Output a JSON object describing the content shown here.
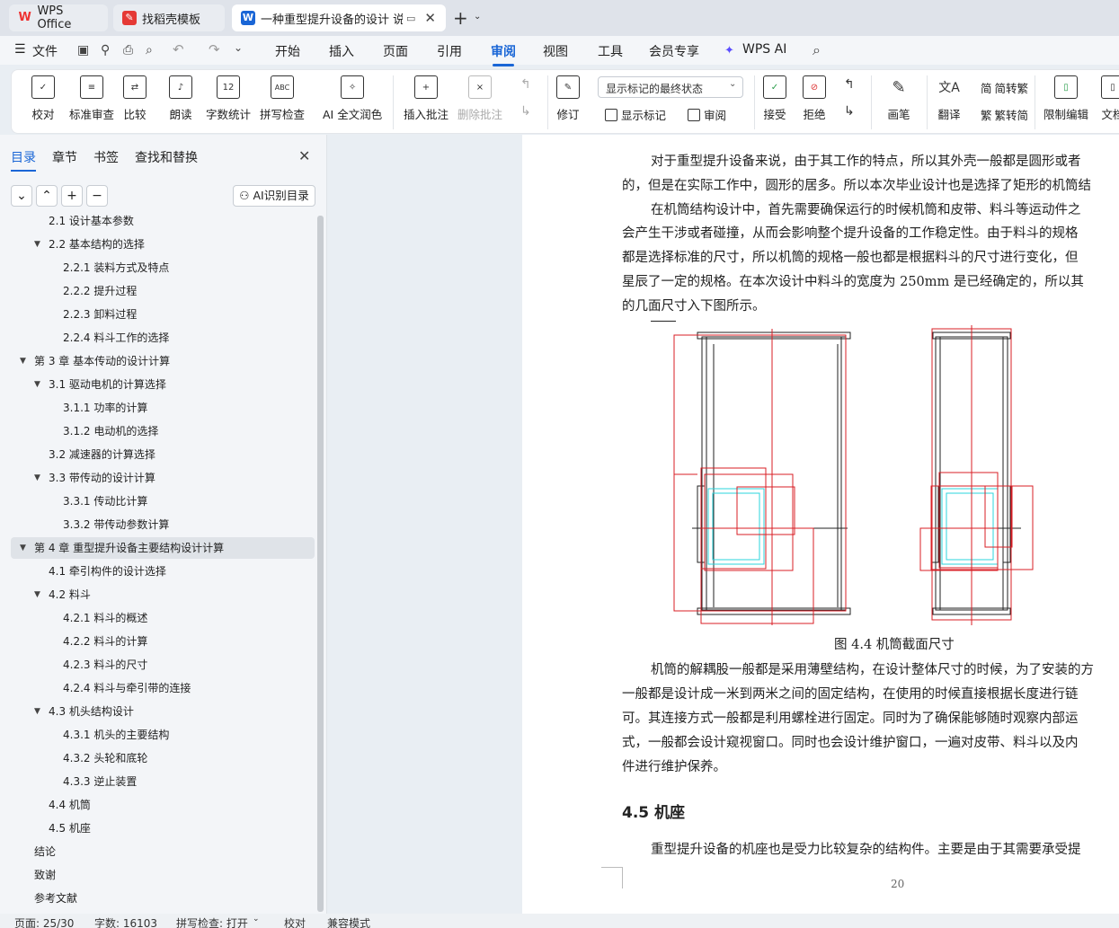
{
  "tabs": [
    {
      "label": "WPS Office"
    },
    {
      "label": "找稻壳模板"
    },
    {
      "label": "一种重型提升设备的设计 说明"
    }
  ],
  "menu": {
    "file": "文件",
    "items": [
      "开始",
      "插入",
      "页面",
      "引用",
      "审阅",
      "视图",
      "工具",
      "会员专享"
    ],
    "wps_ai": "WPS AI"
  },
  "ribbon": {
    "proofread": "校对",
    "std_review": "标准审查",
    "compare": "比较",
    "read_aloud": "朗读",
    "word_count": "字数统计",
    "spell_check": "拼写检查",
    "ai_polish": "AI 全文润色",
    "insert_comment": "插入批注",
    "delete_comment": "删除批注",
    "track": "修订",
    "show_mode": "显示标记的最终状态",
    "show_markup": "显示标记",
    "review": "审阅",
    "accept": "接受",
    "reject": "拒绝",
    "pen": "画笔",
    "translate": "翻译",
    "to_trad": "简转繁",
    "to_simp": "繁转简",
    "restrict": "限制编辑",
    "doc": "文档"
  },
  "nav": {
    "tabs": [
      "目录",
      "章节",
      "书签",
      "查找和替换"
    ],
    "ai_toc": "AI识别目录"
  },
  "toc": [
    {
      "t": "2.1 设计基本参数",
      "l": 2,
      "e": ""
    },
    {
      "t": "2.2 基本结构的选择",
      "l": 2,
      "e": "▼"
    },
    {
      "t": "2.2.1 装料方式及特点",
      "l": 3,
      "e": ""
    },
    {
      "t": "2.2.2 提升过程",
      "l": 3,
      "e": ""
    },
    {
      "t": "2.2.3 卸料过程",
      "l": 3,
      "e": ""
    },
    {
      "t": "2.2.4 料斗工作的选择",
      "l": 3,
      "e": ""
    },
    {
      "t": "第 3 章 基本传动的设计计算",
      "l": 1,
      "e": "▼"
    },
    {
      "t": "3.1 驱动电机的计算选择",
      "l": 2,
      "e": "▼"
    },
    {
      "t": "3.1.1 功率的计算",
      "l": 3,
      "e": ""
    },
    {
      "t": "3.1.2 电动机的选择",
      "l": 3,
      "e": ""
    },
    {
      "t": "3.2 减速器的计算选择",
      "l": 2,
      "e": ""
    },
    {
      "t": "3.3 带传动的设计计算",
      "l": 2,
      "e": "▼"
    },
    {
      "t": "3.3.1 传动比计算",
      "l": 3,
      "e": ""
    },
    {
      "t": "3.3.2 带传动参数计算",
      "l": 3,
      "e": ""
    },
    {
      "t": "第 4 章 重型提升设备主要结构设计计算",
      "l": 1,
      "e": "▼",
      "hl": true
    },
    {
      "t": "4.1 牵引构件的设计选择",
      "l": 2,
      "e": ""
    },
    {
      "t": "4.2 料斗",
      "l": 2,
      "e": "▼"
    },
    {
      "t": "4.2.1 料斗的概述",
      "l": 3,
      "e": ""
    },
    {
      "t": "4.2.2 料斗的计算",
      "l": 3,
      "e": ""
    },
    {
      "t": "4.2.3 料斗的尺寸",
      "l": 3,
      "e": ""
    },
    {
      "t": "4.2.4 料斗与牵引带的连接",
      "l": 3,
      "e": ""
    },
    {
      "t": "4.3 机头结构设计",
      "l": 2,
      "e": "▼"
    },
    {
      "t": "4.3.1 机头的主要结构",
      "l": 3,
      "e": ""
    },
    {
      "t": "4.3.2 头轮和底轮",
      "l": 3,
      "e": ""
    },
    {
      "t": "4.3.3 逆止装置",
      "l": 3,
      "e": ""
    },
    {
      "t": "4.4 机筒",
      "l": 2,
      "e": ""
    },
    {
      "t": "4.5 机座",
      "l": 2,
      "e": ""
    },
    {
      "t": "结论",
      "l": 1,
      "e": ""
    },
    {
      "t": "致谢",
      "l": 1,
      "e": ""
    },
    {
      "t": "参考文献",
      "l": 1,
      "e": ""
    }
  ],
  "doc": {
    "lines": [
      "对于重型提升设备来说，由于其工作的特点，所以其外壳一般都是圆形或者",
      "的，但是在实际工作中，圆形的居多。所以本次毕业设计也是选择了矩形的机筒结",
      "在机筒结构设计中，首先需要确保运行的时候机筒和皮带、料斗等运动件之",
      "会产生干涉或者碰撞，从而会影响整个提升设备的工作稳定性。由于料斗的规格",
      "都是选择标准的尺寸，所以机筒的规格一般也都是根据料斗的尺寸进行变化，但",
      "星辰了一定的规格。在本次设计中料斗的宽度为 250mm 是已经确定的，所以其",
      "的几面尺寸入下图所示。"
    ],
    "caption": "图 4.4 机筒截面尺寸",
    "lines2": [
      "机筒的解耦股一般都是采用薄壁结构，在设计整体尺寸的时候，为了安装的方",
      "一般都是设计成一米到两米之间的固定结构，在使用的时候直接根据长度进行链",
      "可。其连接方式一般都是利用螺栓进行固定。同时为了确保能够随时观察内部运",
      "式，一般都会设计窥视窗口。同时也会设计维护窗口，一遍对皮带、料斗以及内",
      "件进行维护保养。"
    ],
    "heading": "4.5 机座",
    "last_line": "重型提升设备的机座也是受力比较复杂的结构件。主要是由于其需要承受提",
    "page_no": "20"
  },
  "status": {
    "page": "页面: 25/30",
    "words": "字数: 16103",
    "spell": "拼写检查: 打开",
    "proof": "校对",
    "compat": "兼容模式"
  }
}
